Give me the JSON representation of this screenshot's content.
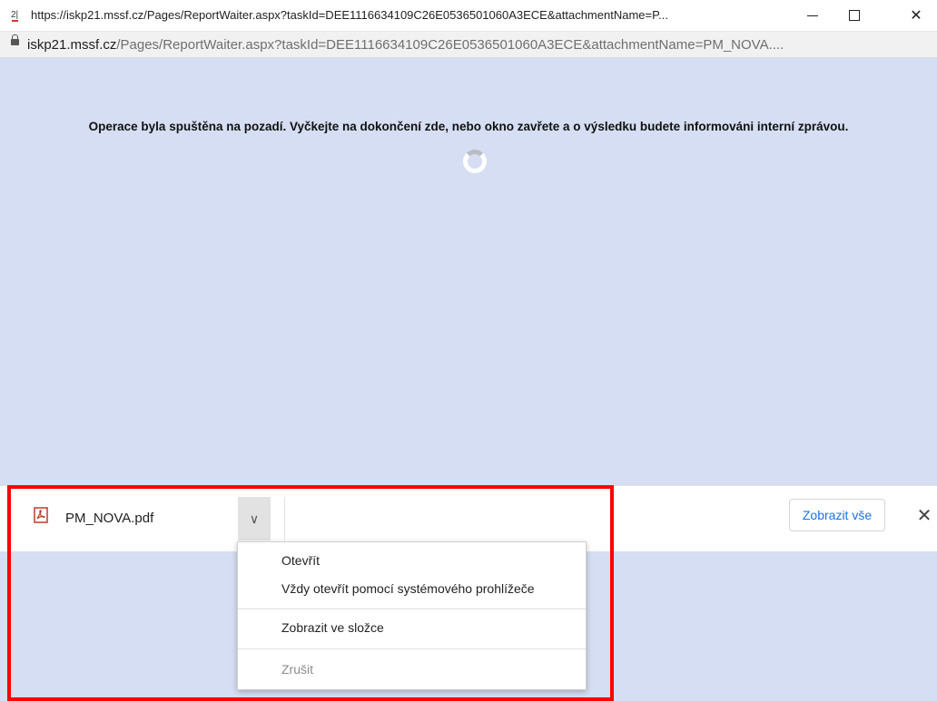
{
  "window": {
    "title": "https://iskp21.mssf.cz/Pages/ReportWaiter.aspx?taskId=DEE1116634109C26E0536501060A3ECE&attachmentName=P...",
    "icon": "app-icon"
  },
  "address": {
    "host": "iskp21.mssf.cz",
    "path": "/Pages/ReportWaiter.aspx?taskId=DEE1116634109C26E0536501060A3ECE&attachmentName=PM_NOVA...."
  },
  "page": {
    "message": "Operace byla spuštěna na pozadí. Vyčkejte na dokončení zde, nebo okno zavřete a o výsledku budete informováni interní zprávou."
  },
  "download": {
    "file_name": "PM_NOVA.pdf",
    "show_all": "Zobrazit vše"
  },
  "menu": {
    "open": "Otevřít",
    "always_open_system": "Vždy otevřít pomocí systémového prohlížeče",
    "show_in_folder": "Zobrazit ve složce",
    "cancel": "Zrušit"
  },
  "colors": {
    "page_bg": "#d6def3",
    "accent": "#1a73e8",
    "highlight": "#ff0000"
  }
}
